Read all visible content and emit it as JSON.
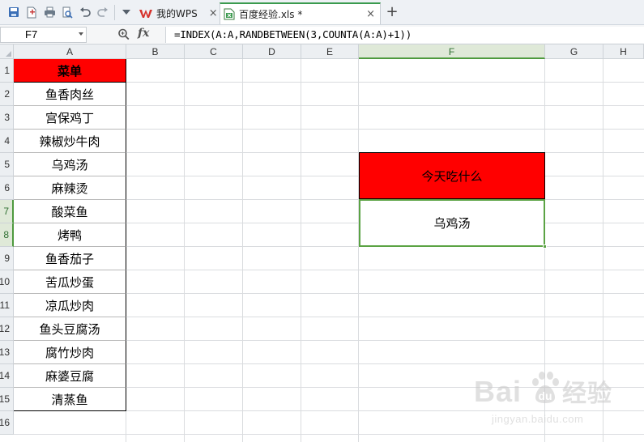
{
  "toolbar": {
    "icons": [
      "save-icon",
      "new-doc-icon",
      "print-icon",
      "print-preview-icon",
      "undo-icon",
      "redo-icon",
      "more-dropdown-icon"
    ]
  },
  "tabs": [
    {
      "label": "我的WPS",
      "close": "×",
      "active": false,
      "icon": "wps-logo-icon"
    },
    {
      "label": "百度经验.xls *",
      "close": "×",
      "active": true,
      "icon": "spreadsheet-file-icon"
    }
  ],
  "new_tab": "+",
  "formula_bar": {
    "name_box": "F7",
    "fx_label": "fx",
    "formula": "=INDEX(A:A,RANDBETWEEN(3,COUNTA(A:A)+1))"
  },
  "columns": [
    "A",
    "B",
    "C",
    "D",
    "E",
    "F",
    "G",
    "H"
  ],
  "selected_column": "F",
  "rows": [
    "1",
    "2",
    "3",
    "4",
    "5",
    "6",
    "7",
    "8",
    "9",
    "10",
    "11",
    "12",
    "13",
    "14",
    "15",
    "16"
  ],
  "selected_rows": [
    "7",
    "8"
  ],
  "column_a": {
    "header": "菜单",
    "items": [
      "鱼香肉丝",
      "宫保鸡丁",
      "辣椒炒牛肉",
      "乌鸡汤",
      "麻辣烫",
      "酸菜鱼",
      "烤鸭",
      "鱼香茄子",
      "苦瓜炒蛋",
      "凉瓜炒肉",
      "鱼头豆腐汤",
      "腐竹炒肉",
      "麻婆豆腐",
      "清蒸鱼"
    ]
  },
  "f_block": {
    "title": "今天吃什么",
    "result": "乌鸡汤"
  },
  "colors": {
    "header_fill": "#ff0000",
    "selection_green": "#5ba344"
  },
  "watermark": {
    "logo": "Bai",
    "logo_suffix": "经验",
    "url": "jingyan.baidu.com"
  }
}
